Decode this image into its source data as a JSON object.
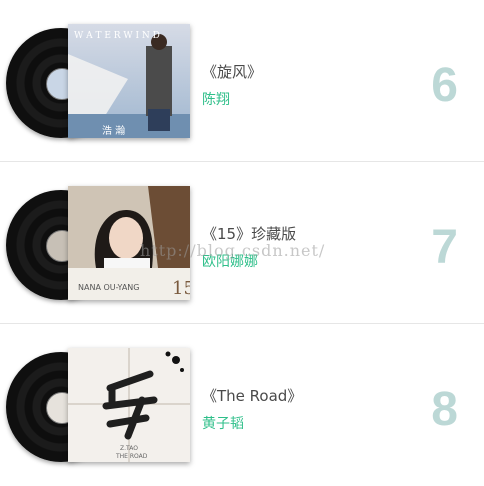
{
  "items": [
    {
      "title": "《旋风》",
      "artist": "陈翔",
      "rank": "6",
      "cover_text_top": "W A T E R W I N D",
      "cover_text_bottom": "浩 瀚"
    },
    {
      "title": "《15》珍藏版",
      "artist": "欧阳娜娜",
      "rank": "7",
      "cover_text_bottom": "NANA OU-YANG",
      "cover_mark": "15"
    },
    {
      "title": "《The Road》",
      "artist": "黄子韬",
      "rank": "8",
      "cover_text_bottom": "Z.TAO",
      "cover_text_bottom2": "THE ROAD"
    }
  ],
  "watermark": "http://blog.csdn.net/",
  "colors": {
    "artist": "#2fbf8a",
    "rank": "#bcd8d6",
    "divider": "#e6e6e6"
  }
}
